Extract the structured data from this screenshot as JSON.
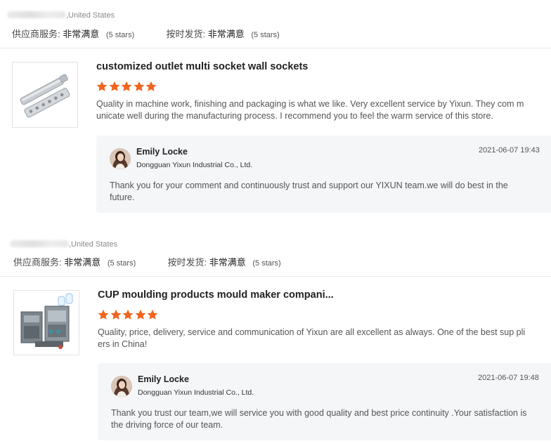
{
  "reviews": [
    {
      "buyer_country": ",United States",
      "rating_supplier_label": "供应商服务:",
      "rating_supplier_value": "非常满意",
      "rating_supplier_stars": "(5 stars)",
      "rating_shipping_label": "按时发货:",
      "rating_shipping_value": "非常满意",
      "rating_shipping_stars": "(5 stars)",
      "product_title": "customized outlet multi socket wall sockets",
      "product_icon": "socket-strip-icon",
      "star_rating": 5,
      "review_text": "Quality in machine work, finishing and packaging is what we like. Very excellent service by Yixun. They com municate well during the manufacturing process. I recommend you to feel the warm service of this store.",
      "reply": {
        "name": "Emily Locke",
        "company": "Dongguan Yixun Industrial Co., Ltd.",
        "date": "2021-06-07 19:43",
        "text": "Thank you for your comment and continuously trust and support our YIXUN team.we will do best in the future."
      }
    },
    {
      "buyer_country": ",United States",
      "rating_supplier_label": "供应商服务:",
      "rating_supplier_value": "非常满意",
      "rating_supplier_stars": "(5 stars)",
      "rating_shipping_label": "按时发货:",
      "rating_shipping_value": "非常满意",
      "rating_shipping_stars": "(5 stars)",
      "product_title": "CUP moulding products mould maker compani...",
      "product_icon": "mould-icon",
      "star_rating": 5,
      "review_text": "Quality, price, delivery, service and communication of Yixun are all excellent as always. One of the best sup pliers in China!",
      "reply": {
        "name": "Emily Locke",
        "company": "Dongguan Yixun Industrial Co., Ltd.",
        "date": "2021-06-07 19:48",
        "text": "Thank you trust our team,we will service you with good quality and best price continuity .Your satisfaction is the driving force of our team."
      }
    }
  ],
  "colors": {
    "star": "#f0641e",
    "reply_bg": "#f5f6f8",
    "divider": "#e8e8e8"
  }
}
